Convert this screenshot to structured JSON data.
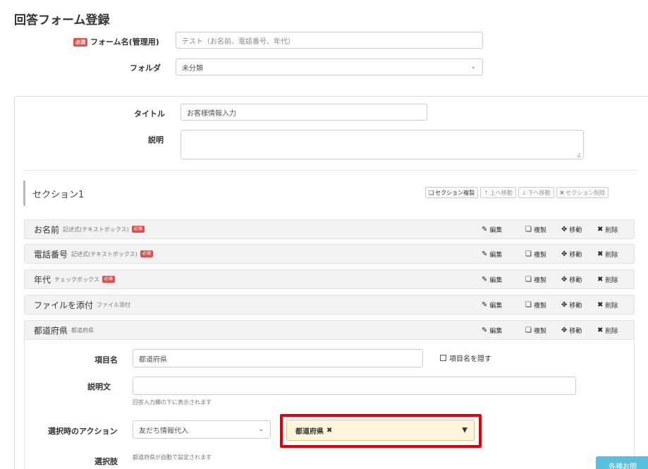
{
  "page": {
    "title": "回答フォーム登録"
  },
  "form": {
    "required_badge": "必須",
    "name_label": "フォーム名(管理用)",
    "name_value": "テスト（お名前、電話番号、年代）",
    "folder_label": "フォルダ",
    "folder_value": "未分類",
    "title_label": "タイトル",
    "title_value": "お客様情報入力",
    "desc_label": "説明",
    "desc_value": ""
  },
  "section": {
    "name": "セクション1",
    "buttons": {
      "copy": "セクション複製",
      "up": "上へ移動",
      "down": "下へ移動",
      "delete": "セクション削除"
    }
  },
  "item_actions": {
    "edit": "編集",
    "duplicate": "複製",
    "move": "移動",
    "delete": "削除"
  },
  "items": [
    {
      "name": "お名前",
      "type": "記述式(テキストボックス)",
      "required": true
    },
    {
      "name": "電話番号",
      "type": "記述式(テキストボックス)",
      "required": true
    },
    {
      "name": "年代",
      "type": "チェックボックス",
      "required": true
    },
    {
      "name": "ファイルを添付",
      "type": "ファイル添付",
      "required": false
    },
    {
      "name": "都道府県",
      "type": "都道府県",
      "required": false
    }
  ],
  "detail": {
    "item_name_label": "項目名",
    "item_name_value": "都道府県",
    "hide_label": "項目名を隠す",
    "desc_label": "説明文",
    "desc_value": "",
    "desc_help": "回答入力欄の下に表示されます",
    "action_label": "選択時のアクション",
    "action_value": "友だち情報代入",
    "tag_value": "都道府県",
    "choices_label": "選択肢",
    "choices_help": "都道府県が自動で設定されます"
  },
  "corner_button": "各種お問"
}
